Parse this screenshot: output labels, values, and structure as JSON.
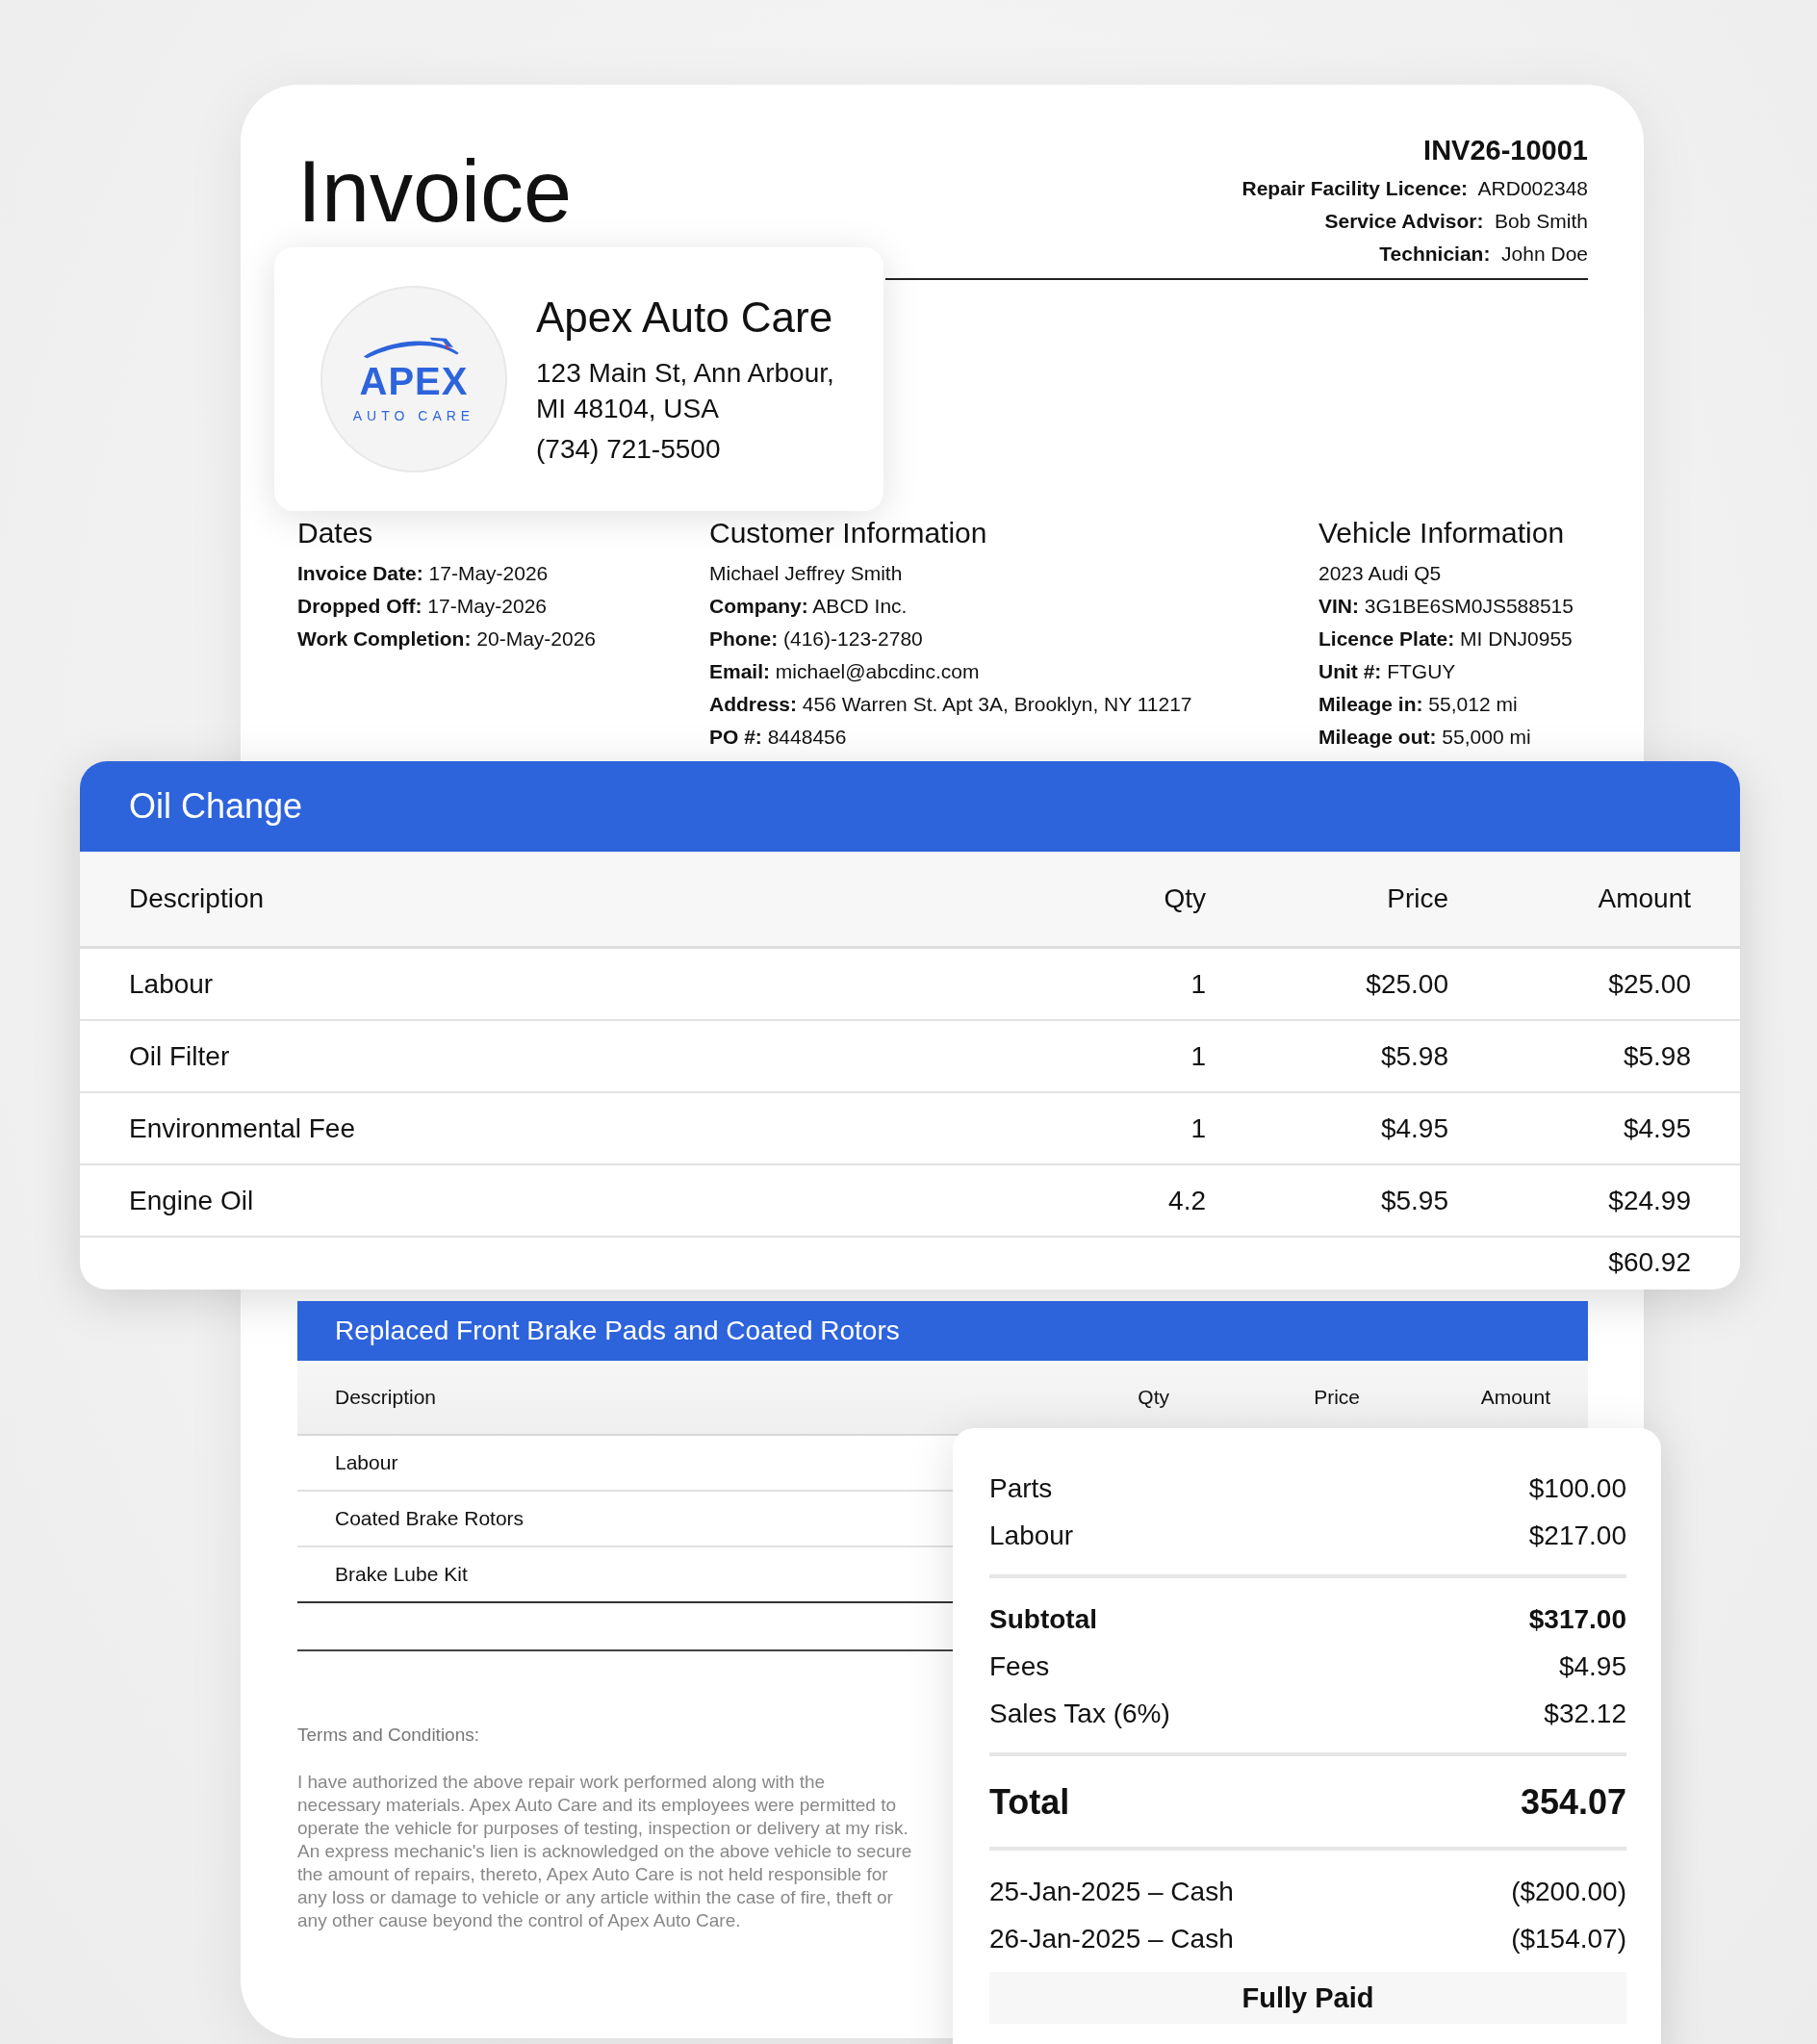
{
  "title": "Invoice",
  "invoice_number": "INV26-10001",
  "meta": [
    "**Repair Facility Licence:**  ARD002348",
    "**Service Advisor:**  Bob Smith",
    "**Technician:**  John Doe"
  ],
  "shop": {
    "wordmark": "APEX",
    "tagline": "AUTO CARE",
    "name": "Apex Auto Care",
    "address_lines": [
      "123 Main St, Ann Arbour,",
      "MI 48104, USA"
    ],
    "phone": "(734) 721-5500"
  },
  "info_sections": [
    {
      "heading": "Dates",
      "lines": [
        "**Invoice Date:** 17-May-2026",
        "**Dropped Off:** 17-May-2026",
        "**Work Completion:** 20-May-2026"
      ]
    },
    {
      "heading": "Customer Information",
      "lines": [
        "Michael Jeffrey Smith",
        "**Company:** ABCD Inc.",
        "**Phone:** (416)-123-2780",
        "**Email:** michael@abcdinc.com",
        "**Address:** 456 Warren St. Apt 3A, Brooklyn, NY 11217",
        "**PO #:** 8448456"
      ]
    },
    {
      "heading": "Vehicle Information",
      "lines": [
        "2023 Audi Q5",
        "**VIN:** 3G1BE6SM0JS588515",
        "**Licence Plate:** MI DNJ0955",
        "**Unit #:** FTGUY",
        "**Mileage in:** 55,012 mi",
        "**Mileage out:** 55,000 mi"
      ]
    }
  ],
  "featured_job": {
    "title": "Oil Change",
    "columns": [
      "Description",
      "Qty",
      "Price",
      "Amount"
    ],
    "rows": [
      {
        "description": "Labour",
        "qty": "1",
        "price": "$25.00",
        "amount": "$25.00"
      },
      {
        "description": "Oil Filter",
        "qty": "1",
        "price": "$5.98",
        "amount": "$5.98"
      },
      {
        "description": "Environmental Fee",
        "qty": "1",
        "price": "$4.95",
        "amount": "$4.95"
      },
      {
        "description": "Engine Oil",
        "qty": "4.2",
        "price": "$5.95",
        "amount": "$24.99"
      }
    ],
    "total": "$60.92"
  },
  "job": {
    "title": "Replaced Front Brake Pads and Coated Rotors",
    "columns": [
      "Description",
      "Qty",
      "Price",
      "Amount"
    ],
    "rows": [
      {
        "description": "Labour"
      },
      {
        "description": "Coated Brake Rotors"
      },
      {
        "description": "Brake Lube Kit"
      }
    ]
  },
  "terms": {
    "heading": "Terms and Conditions:",
    "body": "I have authorized the above repair work performed along with the necessary materials. Apex Auto Care and its employees were permitted to operate the vehicle for purposes of testing, inspection or delivery at my risk. An express mechanic's lien is acknowledged on the above vehicle to secure the amount of repairs,  thereto, Apex Auto Care is not held responsible for any loss or damage to vehicle or any article within the case of fire, theft or any other cause beyond the control of Apex Auto Care."
  },
  "summary": {
    "groups": [
      [
        {
          "kind": "line",
          "label": "Parts",
          "value": "$100.00"
        },
        {
          "kind": "line",
          "label": "Labour",
          "value": "$217.00"
        }
      ],
      [
        {
          "kind": "subtotal",
          "label": "Subtotal",
          "value": "$317.00"
        },
        {
          "kind": "line",
          "label": "Fees",
          "value": "$4.95"
        },
        {
          "kind": "line",
          "label": "Sales Tax (6%)",
          "value": "$32.12"
        }
      ],
      [
        {
          "kind": "total",
          "label": "Total",
          "value": "354.07"
        }
      ],
      [
        {
          "kind": "line",
          "label": "25-Jan-2025 – Cash",
          "value": "($200.00)"
        },
        {
          "kind": "line",
          "label": "26-Jan-2025 – Cash",
          "value": "($154.07)"
        }
      ]
    ],
    "status": "Fully Paid"
  }
}
